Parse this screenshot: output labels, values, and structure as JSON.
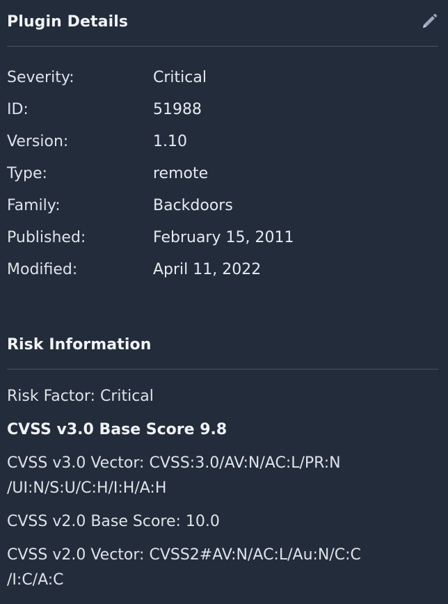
{
  "plugin_details": {
    "title": "Plugin Details",
    "edit_icon": "pencil-icon",
    "rows": [
      {
        "label": "Severity:",
        "value": "Critical"
      },
      {
        "label": "ID:",
        "value": "51988"
      },
      {
        "label": "Version:",
        "value": "1.10"
      },
      {
        "label": "Type:",
        "value": "remote"
      },
      {
        "label": "Family:",
        "value": "Backdoors"
      },
      {
        "label": "Published:",
        "value": "February 15, 2011"
      },
      {
        "label": "Modified:",
        "value": "April 11, 2022"
      }
    ]
  },
  "risk_information": {
    "title": "Risk Information",
    "risk_factor": "Risk Factor: Critical",
    "cvss3_base_score": "CVSS v3.0 Base Score 9.8",
    "cvss3_vector_line1": "CVSS v3.0 Vector: CVSS:3.0/AV:N/AC:L/PR:N",
    "cvss3_vector_line2": "/UI:N/S:U/C:H/I:H/A:H",
    "cvss2_base_score": "CVSS v2.0 Base Score: 10.0",
    "cvss2_vector_line1": "CVSS v2.0 Vector: CVSS2#AV:N/AC:L/Au:N/C:C",
    "cvss2_vector_line2": "/I:C/A:C"
  },
  "colors": {
    "background": "#232c3b",
    "text": "#dfe3e8",
    "divider": "#4a5466",
    "icon": "#9aa7bd"
  }
}
